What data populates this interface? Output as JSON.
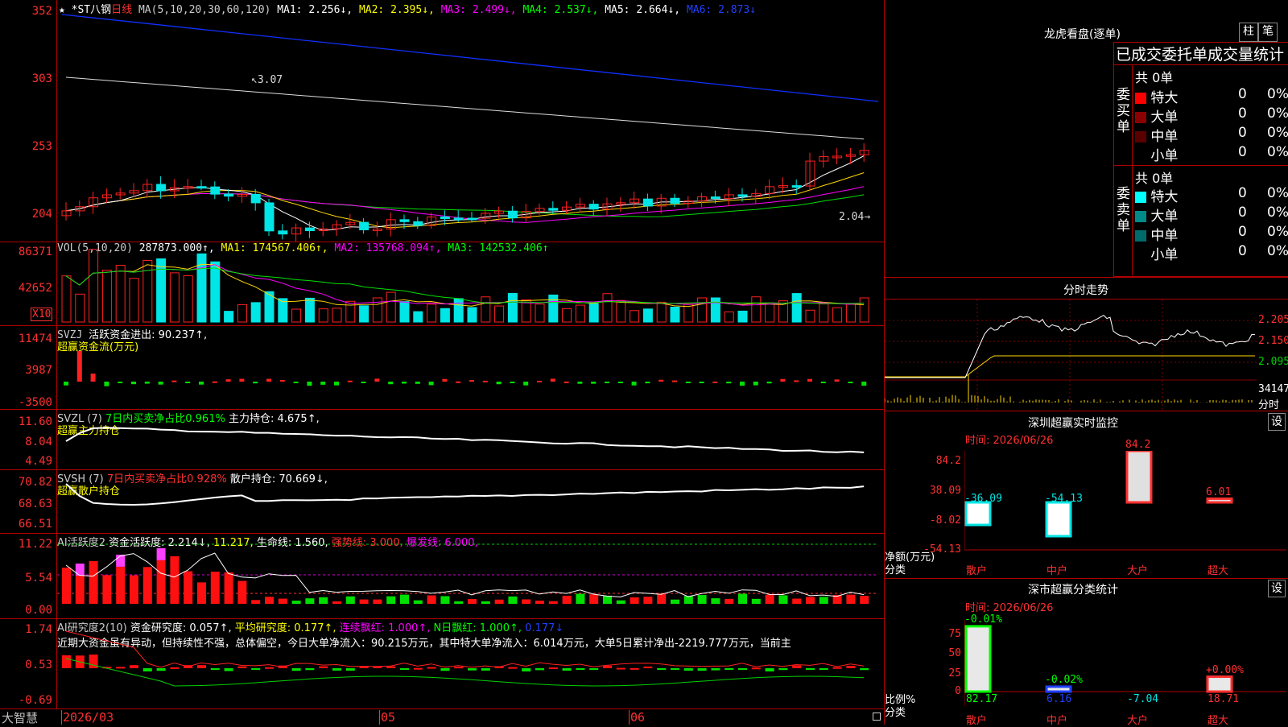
{
  "colors": {
    "up": "#ff2020",
    "down": "#00e5e5",
    "ma1": "#ffffff",
    "ma2": "#ffff00",
    "ma3": "#ff00ff",
    "ma4": "#00ff00",
    "ma6": "#0000ff",
    "gridRed": "#b00000",
    "bg": "#000000"
  },
  "main": {
    "star": "★",
    "code": "*ST八钢",
    "period": "日线",
    "ma_params": "MA(5,10,20,30,60,120)",
    "ma1": "MA1: 2.256↓,",
    "ma2": "MA2: 2.395↓,",
    "ma3": "MA3: 2.499↓,",
    "ma4": "MA4: 2.537↓,",
    "ma5": "MA5: 2.664↓,",
    "ma6": "MA6: 2.873↓",
    "yticks": [
      "352",
      "303",
      "253",
      "204"
    ],
    "high_label": "3.07",
    "low_label": "2.04"
  },
  "vol": {
    "title": "VOL(5,10,20)",
    "value": "287873.000↑,",
    "ma1": "MA1: 174567.406↑,",
    "ma2": "MA2: 135768.094↑,",
    "ma3": "MA3: 142532.406↑",
    "yticks": [
      "86371",
      "42652"
    ],
    "unit": "X10"
  },
  "svzj": {
    "title": "SVZJ",
    "subtitle": "活跃资金进出: 90.237↑,",
    "desc": "超赢资金流(万元)",
    "yticks": [
      "11474",
      "3987",
      "-3500"
    ]
  },
  "svzl": {
    "title": "SVZL (7)",
    "pct": "7日内买卖净占比0.961%",
    "hold": "主力持仓: 4.675↑,",
    "desc": "超赢主力持仓",
    "yticks": [
      "11.60",
      "8.04",
      "4.49"
    ]
  },
  "svsh": {
    "title": "SVSH (7)",
    "pct": "7日内买卖净占比0.928%",
    "hold": "散户持仓: 70.669↓,",
    "desc": "超赢散户持仓",
    "yticks": [
      "70.82",
      "68.63",
      "66.51"
    ]
  },
  "ai1": {
    "title": "AI活跃度2",
    "v1": "资金活跃度: 2.214↓,",
    "v2": "11.217,",
    "v3": "生命线: 1.560,",
    "v4": "强势线: 3.000,",
    "v5": "爆发线: 6.000,",
    "yticks": [
      "11.22",
      "5.54",
      "0.00"
    ]
  },
  "ai2": {
    "title": "AI研究度2(10)",
    "v1": "资金研究度: 0.057↑,",
    "v2": "平均研究度: 0.177↑,",
    "v3": "连续飘红: 1.000↑,",
    "v4": "N日飘红: 1.000↑,",
    "v5": "0.177↓",
    "text": "近期大资金虽有异动，但持续性不强，总体偏空，今日大单净流入：90.215万元，其中特大单净流入：6.014万元，大单5日累计净出-2219.777万元，当前主",
    "yticks": [
      "1.74",
      "0.53",
      "-0.69"
    ]
  },
  "xaxis": {
    "brand": "大智慧",
    "labels": [
      "2026/03",
      "05",
      "06"
    ]
  },
  "right": {
    "lhb_title": "龙虎看盘(逐单)",
    "btn1": "柱",
    "btn2": "笔",
    "stat_title": "已成交委托单成交量统计",
    "buy": {
      "side": "委买单",
      "total": "共 0单",
      "rows": [
        {
          "name": "特大",
          "v": "0",
          "p": "0%",
          "c": "#ff0000"
        },
        {
          "name": "大单",
          "v": "0",
          "p": "0%",
          "c": "#8b0000"
        },
        {
          "name": "中单",
          "v": "0",
          "p": "0%",
          "c": "#5a0000"
        },
        {
          "name": "小单",
          "v": "0",
          "p": "0%",
          "c": "#000000"
        }
      ]
    },
    "sell": {
      "side": "委卖单",
      "total": "共 0单",
      "rows": [
        {
          "name": "特大",
          "v": "0",
          "p": "0%",
          "c": "#00ffff"
        },
        {
          "name": "大单",
          "v": "0",
          "p": "0%",
          "c": "#008b8b"
        },
        {
          "name": "中单",
          "v": "0",
          "p": "0%",
          "c": "#006b6b"
        },
        {
          "name": "小单",
          "v": "0",
          "p": "0%",
          "c": "#000000"
        }
      ]
    },
    "fs_title": "分时走势",
    "fs_yticks": [
      "2.205",
      "2.150",
      "2.095",
      "34147",
      "分时"
    ],
    "sz_title": "深圳超赢实时监控",
    "sz_btn": "设",
    "sz_time": "时间: 2026/06/26",
    "sz_yticks": [
      "84.2",
      "38.09",
      "-8.02",
      "-54.13"
    ],
    "sz_ylabel": "净额(万元)",
    "sz_xlabel": "分类",
    "sz_bars": [
      {
        "cat": "散户",
        "val": "-36.09",
        "v": -36.09
      },
      {
        "cat": "中户",
        "val": "-54.13",
        "v": -54.13
      },
      {
        "cat": "大户",
        "val": "84.2",
        "v": 84.2
      },
      {
        "cat": "超大",
        "val": "6.01",
        "v": 6.01
      }
    ],
    "ss_title": "深市超赢分类统计",
    "ss_btn": "设",
    "ss_time": "时间: 2026/06/26",
    "ss_yticks": [
      "75",
      "50",
      "25",
      "0"
    ],
    "ss_ylabel": "比例%",
    "ss_xlabel": "分类",
    "ss_bars": [
      {
        "cat": "散户",
        "top": "-0.01%",
        "bottom": "82.17",
        "v": 82.17
      },
      {
        "cat": "中户",
        "top": "-0.02%",
        "bottom": "6.16",
        "v": 6.16
      },
      {
        "cat": "大户",
        "top": "",
        "bottom": "-7.04",
        "v": 0
      },
      {
        "cat": "超大",
        "top": "+0.00%",
        "bottom": "18.71",
        "v": 18.71
      }
    ]
  }
}
